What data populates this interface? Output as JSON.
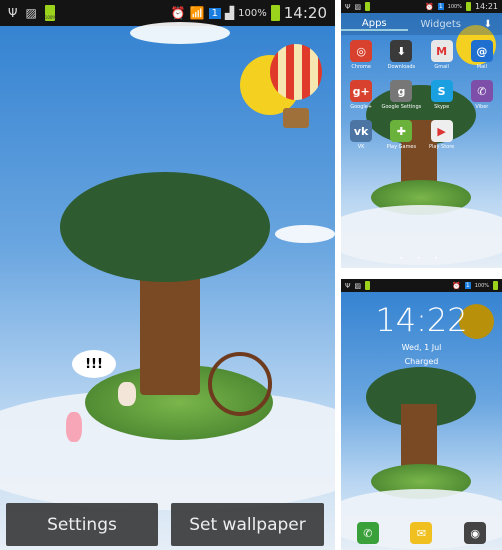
{
  "left": {
    "status": {
      "battery_small": "100%",
      "signal_text": "100%",
      "time": "14:20",
      "notification_badge": "1"
    },
    "buttons": {
      "settings": "Settings",
      "set_wallpaper": "Set wallpaper"
    },
    "speech_bubble": "!!!"
  },
  "top_right": {
    "status": {
      "signal_text": "100%",
      "time": "14:21",
      "notification_badge": "1"
    },
    "tabs": [
      "Apps",
      "Widgets"
    ],
    "apps": [
      {
        "label": "Chrome",
        "color": "#d9412f",
        "glyph": "◎"
      },
      {
        "label": "Downloads",
        "color": "#3a3a3a",
        "glyph": "⬇"
      },
      {
        "label": "Gmail",
        "color": "#e8e8e8",
        "glyph": "M"
      },
      {
        "label": "Mail",
        "color": "#1f6fd0",
        "glyph": "@"
      },
      {
        "label": "Google+",
        "color": "#d9412f",
        "glyph": "g+"
      },
      {
        "label": "Google Settings",
        "color": "#777777",
        "glyph": "g"
      },
      {
        "label": "Skype",
        "color": "#1aa0e0",
        "glyph": "S"
      },
      {
        "label": "Viber",
        "color": "#7d4fa8",
        "glyph": "✆"
      },
      {
        "label": "VK",
        "color": "#4c75a3",
        "glyph": "vk"
      },
      {
        "label": "Play Games",
        "color": "#6ab23c",
        "glyph": "✚"
      },
      {
        "label": "Play Store",
        "color": "#eeeeee",
        "glyph": "▶"
      }
    ]
  },
  "bottom_right": {
    "status": {
      "signal_text": "100%",
      "notification_badge": "1"
    },
    "clock": "14:22",
    "date": "Wed, 1 Jul",
    "charge_status": "Charged",
    "dock": [
      {
        "name": "phone",
        "color": "#3aa03a",
        "glyph": "✆"
      },
      {
        "name": "email",
        "color": "#f0c020",
        "glyph": "✉"
      },
      {
        "name": "camera",
        "color": "#444444",
        "glyph": "◉"
      }
    ]
  }
}
